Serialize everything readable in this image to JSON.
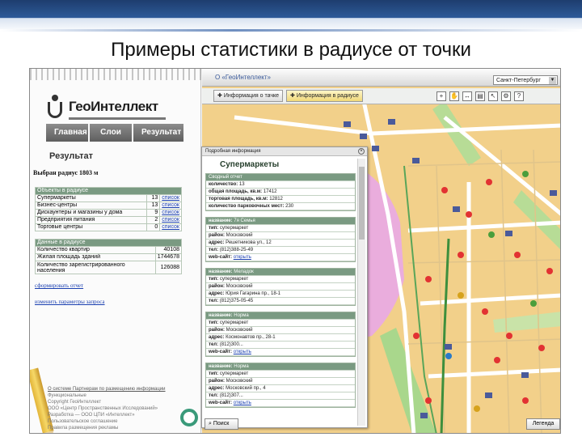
{
  "slide": {
    "title": "Примеры статистики в радиусе от точки"
  },
  "app": {
    "logo_text": "ГеоИнтеллект",
    "tabs": [
      {
        "label": "Главная"
      },
      {
        "label": "Слои"
      },
      {
        "label": "Результат"
      }
    ],
    "result_heading": "Результат",
    "radius_label": "Выбран радиус 1803 м",
    "objects_table": {
      "header": "Объекты в радиусе",
      "rows": [
        {
          "name": "Супермаркеты",
          "count": "13",
          "link": "список"
        },
        {
          "name": "Бизнес-центры",
          "count": "13",
          "link": "список"
        },
        {
          "name": "Дискаунтеры и магазины у дома",
          "count": "9",
          "link": "список"
        },
        {
          "name": "Предприятия питания",
          "count": "2",
          "link": "список"
        },
        {
          "name": "Торговые центры",
          "count": "0",
          "link": "список"
        }
      ]
    },
    "data_table": {
      "header": "Данные в радиусе",
      "rows": [
        {
          "name": "Количество квартир",
          "value": "40108"
        },
        {
          "name": "Жилая площадь зданий",
          "value": "1744678"
        },
        {
          "name": "Количество зарегистрированного населения",
          "value": "126088"
        }
      ]
    },
    "link_report": "сформировать отчет",
    "link_change": "изменить параметры запроса",
    "footer": {
      "line1": "О системе   Партнерам по размещению информации",
      "line2": "Функциональные",
      "line3": "Copyright ГеоИнтеллект",
      "line4": "ООО «Центр Пространственных Исследований»",
      "line5": "Разработка — ООО ЦПИ «Интеллект»",
      "line6": "Пользовательское соглашение",
      "line7": "Правила размещения рекламы"
    }
  },
  "map": {
    "title": "О «ГеоИнтеллект»",
    "city": "Санкт-Петербург",
    "toolbar": {
      "info_objects": "Информация о тачке",
      "info_radius": "Информация в радиусе"
    },
    "search_button": "Поиск",
    "legend_button": "Легенда"
  },
  "popup": {
    "header": "Подробная информация",
    "title": "Супермаркеты",
    "summary": {
      "header": "Сводный отчет",
      "rows": [
        {
          "k": "количество:",
          "v": "13"
        },
        {
          "k": "общая площадь, кв.м:",
          "v": "17412"
        },
        {
          "k": "торговая площадь, кв.м:",
          "v": "12812"
        },
        {
          "k": "количество парковочных мест:",
          "v": "230"
        }
      ]
    },
    "items": [
      {
        "name": "7я Семья",
        "type": "супермаркет",
        "district": "Московский",
        "address": "Решетникова ул., 12",
        "phone": "(812)388-25-49",
        "site": "открыть"
      },
      {
        "name": "Меладок",
        "type": "супермаркет",
        "district": "Московский",
        "address": "Юрия Гагарина пр., 18-1",
        "phone": "(812)375-05-45",
        "site": ""
      },
      {
        "name": "Норма",
        "type": "супермаркет",
        "district": "Московский",
        "address": "Космонавтов пр., 28-1",
        "phone": "(812)300...",
        "site": "открыть"
      },
      {
        "name": "Норма",
        "type": "супермаркет",
        "district": "Московский",
        "address": "Московский пр., 4",
        "phone": "(812)307...",
        "site": "открыть"
      }
    ],
    "labels": {
      "name": "название:",
      "type": "тип:",
      "district": "район:",
      "address": "адрес:",
      "phone": "тел:",
      "site": "web-сайт:"
    }
  }
}
